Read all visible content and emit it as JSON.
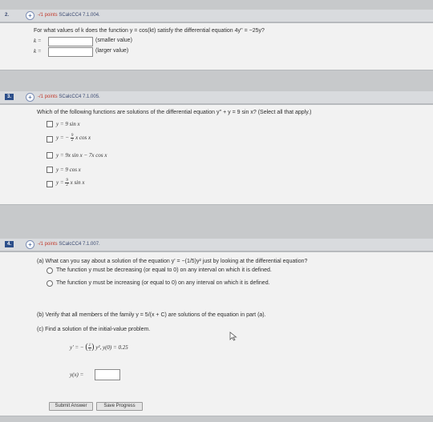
{
  "q2": {
    "number": "2.",
    "points": "-/1 points",
    "code": "SCalcCC4 7.1.004.",
    "prompt": "For what values of k does the function y = cos(kt) satisfy the differential equation 4y'' = −25y?",
    "k_label": "k =",
    "smaller_label": "(smaller value)",
    "larger_label": "(larger value)"
  },
  "q3": {
    "number": "3.",
    "points": "-/1 points",
    "code": "SCalcCC4 7.1.005.",
    "prompt": "Which of the following functions are solutions of the differential equation y'' + y = 9 sin x? (Select all that apply.)",
    "options": [
      {
        "pre": "y = 9 sin x",
        "num": "",
        "den": "",
        "post": ""
      },
      {
        "pre": "y = −",
        "num": "9",
        "den": "2",
        "post": "x cos x"
      },
      {
        "pre": "y = 9x sin x − 7x cos x",
        "num": "",
        "den": "",
        "post": ""
      },
      {
        "pre": "y = 9 cos x",
        "num": "",
        "den": "",
        "post": ""
      },
      {
        "pre": "y =",
        "num": "9",
        "den": "2",
        "post": "x sin x"
      }
    ]
  },
  "q4": {
    "number": "4.",
    "points": "-/1 points",
    "code": "SCalcCC4 7.1.007.",
    "part_a": "(a) What can you say about a solution of the equation y' = −(1/5)y² just by looking at the differential equation?",
    "choice_1": "The function y must be decreasing (or equal to 0) on any interval on which it is defined.",
    "choice_2": "The function y must be increasing (or equal to 0) on any interval on which it is defined.",
    "part_b": "(b) Verify that all members of the family y = 5/(x + C) are solutions of the equation in part (a).",
    "part_c": "(c) Find a solution of the initial-value problem.",
    "ivp_pre": "y' = −",
    "ivp_num": "1",
    "ivp_den": "5",
    "ivp_post": "y², y(0) = 0.25",
    "answer_label": "y(x) =",
    "submit_label": "Submit Answer",
    "save_label": "Save Progress"
  }
}
